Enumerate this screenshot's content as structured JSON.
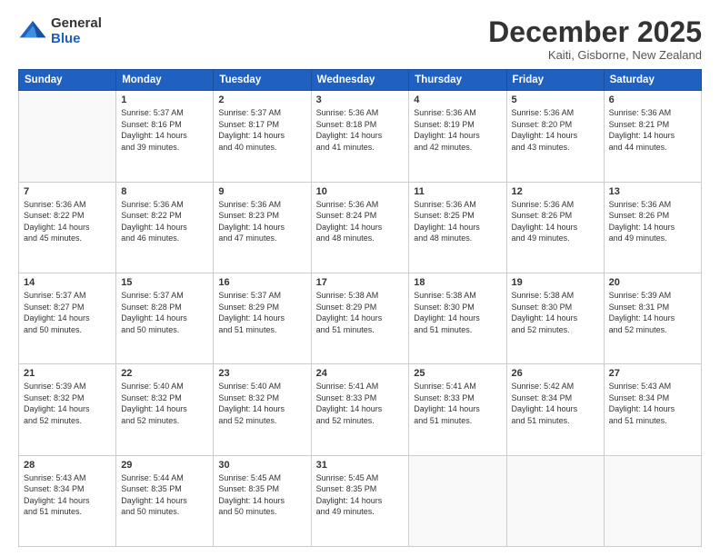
{
  "logo": {
    "general": "General",
    "blue": "Blue"
  },
  "header": {
    "title": "December 2025",
    "subtitle": "Kaiti, Gisborne, New Zealand"
  },
  "weekdays": [
    "Sunday",
    "Monday",
    "Tuesday",
    "Wednesday",
    "Thursday",
    "Friday",
    "Saturday"
  ],
  "weeks": [
    [
      {
        "day": "",
        "info": ""
      },
      {
        "day": "1",
        "info": "Sunrise: 5:37 AM\nSunset: 8:16 PM\nDaylight: 14 hours\nand 39 minutes."
      },
      {
        "day": "2",
        "info": "Sunrise: 5:37 AM\nSunset: 8:17 PM\nDaylight: 14 hours\nand 40 minutes."
      },
      {
        "day": "3",
        "info": "Sunrise: 5:36 AM\nSunset: 8:18 PM\nDaylight: 14 hours\nand 41 minutes."
      },
      {
        "day": "4",
        "info": "Sunrise: 5:36 AM\nSunset: 8:19 PM\nDaylight: 14 hours\nand 42 minutes."
      },
      {
        "day": "5",
        "info": "Sunrise: 5:36 AM\nSunset: 8:20 PM\nDaylight: 14 hours\nand 43 minutes."
      },
      {
        "day": "6",
        "info": "Sunrise: 5:36 AM\nSunset: 8:21 PM\nDaylight: 14 hours\nand 44 minutes."
      }
    ],
    [
      {
        "day": "7",
        "info": "Sunrise: 5:36 AM\nSunset: 8:22 PM\nDaylight: 14 hours\nand 45 minutes."
      },
      {
        "day": "8",
        "info": "Sunrise: 5:36 AM\nSunset: 8:22 PM\nDaylight: 14 hours\nand 46 minutes."
      },
      {
        "day": "9",
        "info": "Sunrise: 5:36 AM\nSunset: 8:23 PM\nDaylight: 14 hours\nand 47 minutes."
      },
      {
        "day": "10",
        "info": "Sunrise: 5:36 AM\nSunset: 8:24 PM\nDaylight: 14 hours\nand 48 minutes."
      },
      {
        "day": "11",
        "info": "Sunrise: 5:36 AM\nSunset: 8:25 PM\nDaylight: 14 hours\nand 48 minutes."
      },
      {
        "day": "12",
        "info": "Sunrise: 5:36 AM\nSunset: 8:26 PM\nDaylight: 14 hours\nand 49 minutes."
      },
      {
        "day": "13",
        "info": "Sunrise: 5:36 AM\nSunset: 8:26 PM\nDaylight: 14 hours\nand 49 minutes."
      }
    ],
    [
      {
        "day": "14",
        "info": "Sunrise: 5:37 AM\nSunset: 8:27 PM\nDaylight: 14 hours\nand 50 minutes."
      },
      {
        "day": "15",
        "info": "Sunrise: 5:37 AM\nSunset: 8:28 PM\nDaylight: 14 hours\nand 50 minutes."
      },
      {
        "day": "16",
        "info": "Sunrise: 5:37 AM\nSunset: 8:29 PM\nDaylight: 14 hours\nand 51 minutes."
      },
      {
        "day": "17",
        "info": "Sunrise: 5:38 AM\nSunset: 8:29 PM\nDaylight: 14 hours\nand 51 minutes."
      },
      {
        "day": "18",
        "info": "Sunrise: 5:38 AM\nSunset: 8:30 PM\nDaylight: 14 hours\nand 51 minutes."
      },
      {
        "day": "19",
        "info": "Sunrise: 5:38 AM\nSunset: 8:30 PM\nDaylight: 14 hours\nand 52 minutes."
      },
      {
        "day": "20",
        "info": "Sunrise: 5:39 AM\nSunset: 8:31 PM\nDaylight: 14 hours\nand 52 minutes."
      }
    ],
    [
      {
        "day": "21",
        "info": "Sunrise: 5:39 AM\nSunset: 8:32 PM\nDaylight: 14 hours\nand 52 minutes."
      },
      {
        "day": "22",
        "info": "Sunrise: 5:40 AM\nSunset: 8:32 PM\nDaylight: 14 hours\nand 52 minutes."
      },
      {
        "day": "23",
        "info": "Sunrise: 5:40 AM\nSunset: 8:32 PM\nDaylight: 14 hours\nand 52 minutes."
      },
      {
        "day": "24",
        "info": "Sunrise: 5:41 AM\nSunset: 8:33 PM\nDaylight: 14 hours\nand 52 minutes."
      },
      {
        "day": "25",
        "info": "Sunrise: 5:41 AM\nSunset: 8:33 PM\nDaylight: 14 hours\nand 51 minutes."
      },
      {
        "day": "26",
        "info": "Sunrise: 5:42 AM\nSunset: 8:34 PM\nDaylight: 14 hours\nand 51 minutes."
      },
      {
        "day": "27",
        "info": "Sunrise: 5:43 AM\nSunset: 8:34 PM\nDaylight: 14 hours\nand 51 minutes."
      }
    ],
    [
      {
        "day": "28",
        "info": "Sunrise: 5:43 AM\nSunset: 8:34 PM\nDaylight: 14 hours\nand 51 minutes."
      },
      {
        "day": "29",
        "info": "Sunrise: 5:44 AM\nSunset: 8:35 PM\nDaylight: 14 hours\nand 50 minutes."
      },
      {
        "day": "30",
        "info": "Sunrise: 5:45 AM\nSunset: 8:35 PM\nDaylight: 14 hours\nand 50 minutes."
      },
      {
        "day": "31",
        "info": "Sunrise: 5:45 AM\nSunset: 8:35 PM\nDaylight: 14 hours\nand 49 minutes."
      },
      {
        "day": "",
        "info": ""
      },
      {
        "day": "",
        "info": ""
      },
      {
        "day": "",
        "info": ""
      }
    ]
  ]
}
